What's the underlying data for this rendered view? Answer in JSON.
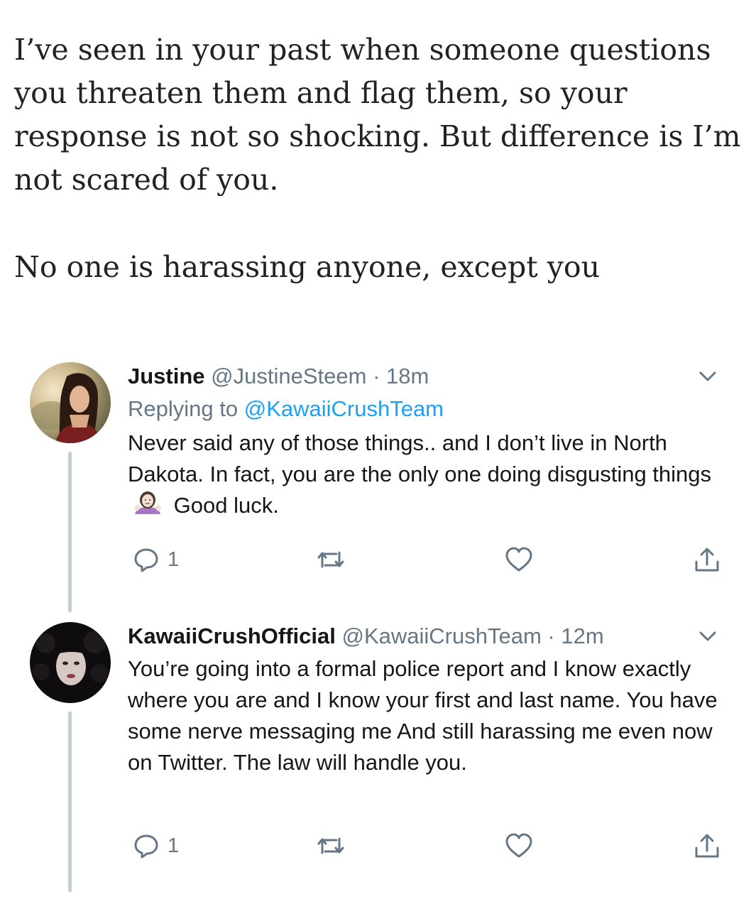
{
  "intro": {
    "paragraph1": "I’ve seen in your past when someone questions you threaten them and flag them, so your response is not so shocking. But difference is I’m not scared of you.",
    "paragraph2": "No one is harassing anyone, except you"
  },
  "tweets": [
    {
      "name": "Justine",
      "handle": "@JustineSteem",
      "separator": "·",
      "time": "18m",
      "replying_prefix": "Replying to ",
      "replying_handle": "@KawaiiCrushTeam",
      "text_before_emoji": "Never said any of those things.. and I don’t live in North Dakota. In fact, you are the only one doing disgusting things",
      "emoji": "woman-shrugging-emoji",
      "text_after_emoji": "Good luck.",
      "reply_count": "1",
      "avatar": "justine-avatar-photo"
    },
    {
      "name": "KawaiiCrushOfficial",
      "handle": "@KawaiiCrushTeam",
      "separator": "·",
      "time": "12m",
      "text": "You’re going into a formal police report and I know exactly where you are and I know your first and last name. You have some nerve messaging me And still harassing me even now on Twitter. The law will handle you.",
      "reply_count": "1",
      "avatar": "kawaiicrush-avatar-photo"
    }
  ],
  "colors": {
    "secondary_text": "#657786",
    "link": "#1da1f2",
    "thread_line": "#c4cfd6",
    "primary_text": "#14171a"
  }
}
